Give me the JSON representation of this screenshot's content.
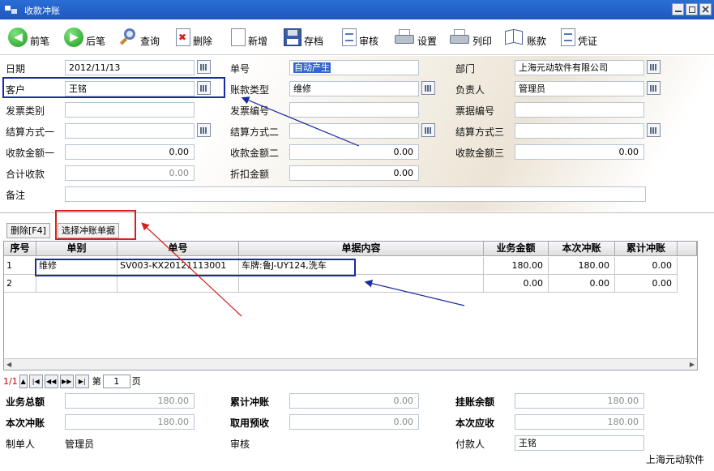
{
  "window": {
    "title": "收款冲账"
  },
  "toolbar": {
    "prev": "前笔",
    "next": "后笔",
    "query": "查询",
    "delete": "删除",
    "new": "新增",
    "save": "存档",
    "review": "审核",
    "settings": "设置",
    "print": "列印",
    "account": "账款",
    "voucher": "凭证"
  },
  "form": {
    "date_label": "日期",
    "date": "2012/11/13",
    "customer_label": "客户",
    "customer": "王铭",
    "invoice_type_label": "发票类别",
    "invoice_type": "",
    "settle1_label": "结算方式一",
    "settle1": "",
    "amount1_label": "收款金额一",
    "amount1": "0.00",
    "total_label": "合计收款",
    "total": "0.00",
    "memo_label": "备注",
    "memo": "",
    "doc_no_label": "单号",
    "doc_no": "自动产生",
    "account_type_label": "账款类型",
    "account_type": "维修",
    "invoice_no_label": "发票编号",
    "invoice_no": "",
    "settle2_label": "结算方式二",
    "settle2": "",
    "amount2_label": "收款金额二",
    "amount2": "0.00",
    "discount_label": "折扣金额",
    "discount": "0.00",
    "dept_label": "部门",
    "dept": "上海元动软件有限公司",
    "owner_label": "负责人",
    "owner": "管理员",
    "bill_no_label": "票据编号",
    "bill_no": "",
    "settle3_label": "结算方式三",
    "settle3": "",
    "amount3_label": "收款金额三",
    "amount3": "0.00"
  },
  "tabs": {
    "delete_f4": "删除[F4]",
    "select_docs": "选择冲账单据"
  },
  "grid": {
    "columns": [
      "序号",
      "单别",
      "单号",
      "单据内容",
      "业务金额",
      "本次冲账",
      "累计冲账"
    ],
    "rows": [
      [
        "1",
        "维修",
        "SV003-KX20121113001",
        "车牌:鲁J-UY124,洗车",
        "180.00",
        "180.00",
        "0.00"
      ],
      [
        "2",
        "",
        "",
        "",
        "0.00",
        "0.00",
        "0.00"
      ]
    ]
  },
  "pager": {
    "current": "1/1",
    "page_label": "第",
    "page_value": "1",
    "page_suffix": "页"
  },
  "footer": {
    "biz_total_label": "业务总额",
    "biz_total": "180.00",
    "cum_offset_label": "累计冲账",
    "cum_offset": "0.00",
    "pending_label": "挂账余额",
    "pending": "180.00",
    "this_offset_label": "本次冲账",
    "this_offset": "180.00",
    "prepay_label": "取用预收",
    "prepay": "0.00",
    "receivable_label": "本次应收",
    "receivable": "180.00",
    "creator_label": "制单人",
    "creator": "管理员",
    "reviewer_label": "审核",
    "payer_label": "付款人",
    "payer": "王铭"
  },
  "credit": "上海元动软件",
  "colors": {
    "titlebar": "#2a6fd6",
    "highlight_blue": "#1a2aa0",
    "highlight_red": "#d81e1e"
  }
}
